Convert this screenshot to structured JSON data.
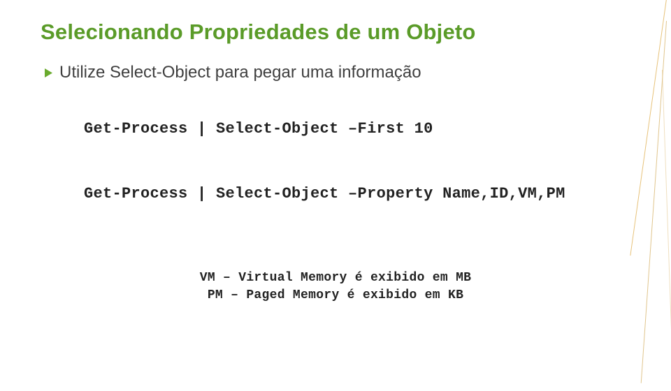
{
  "title": "Selecionando Propriedades de um Objeto",
  "bullet": "Utilize Select-Object para pegar uma informação",
  "code1": "Get-Process  |  Select-Object –First 10",
  "code2": "Get-Process   | Select-Object –Property Name,ID,VM,PM",
  "footer_line1": "VM – Virtual Memory é exibido em MB",
  "footer_line2": "PM – Paged Memory é exibido em KB"
}
